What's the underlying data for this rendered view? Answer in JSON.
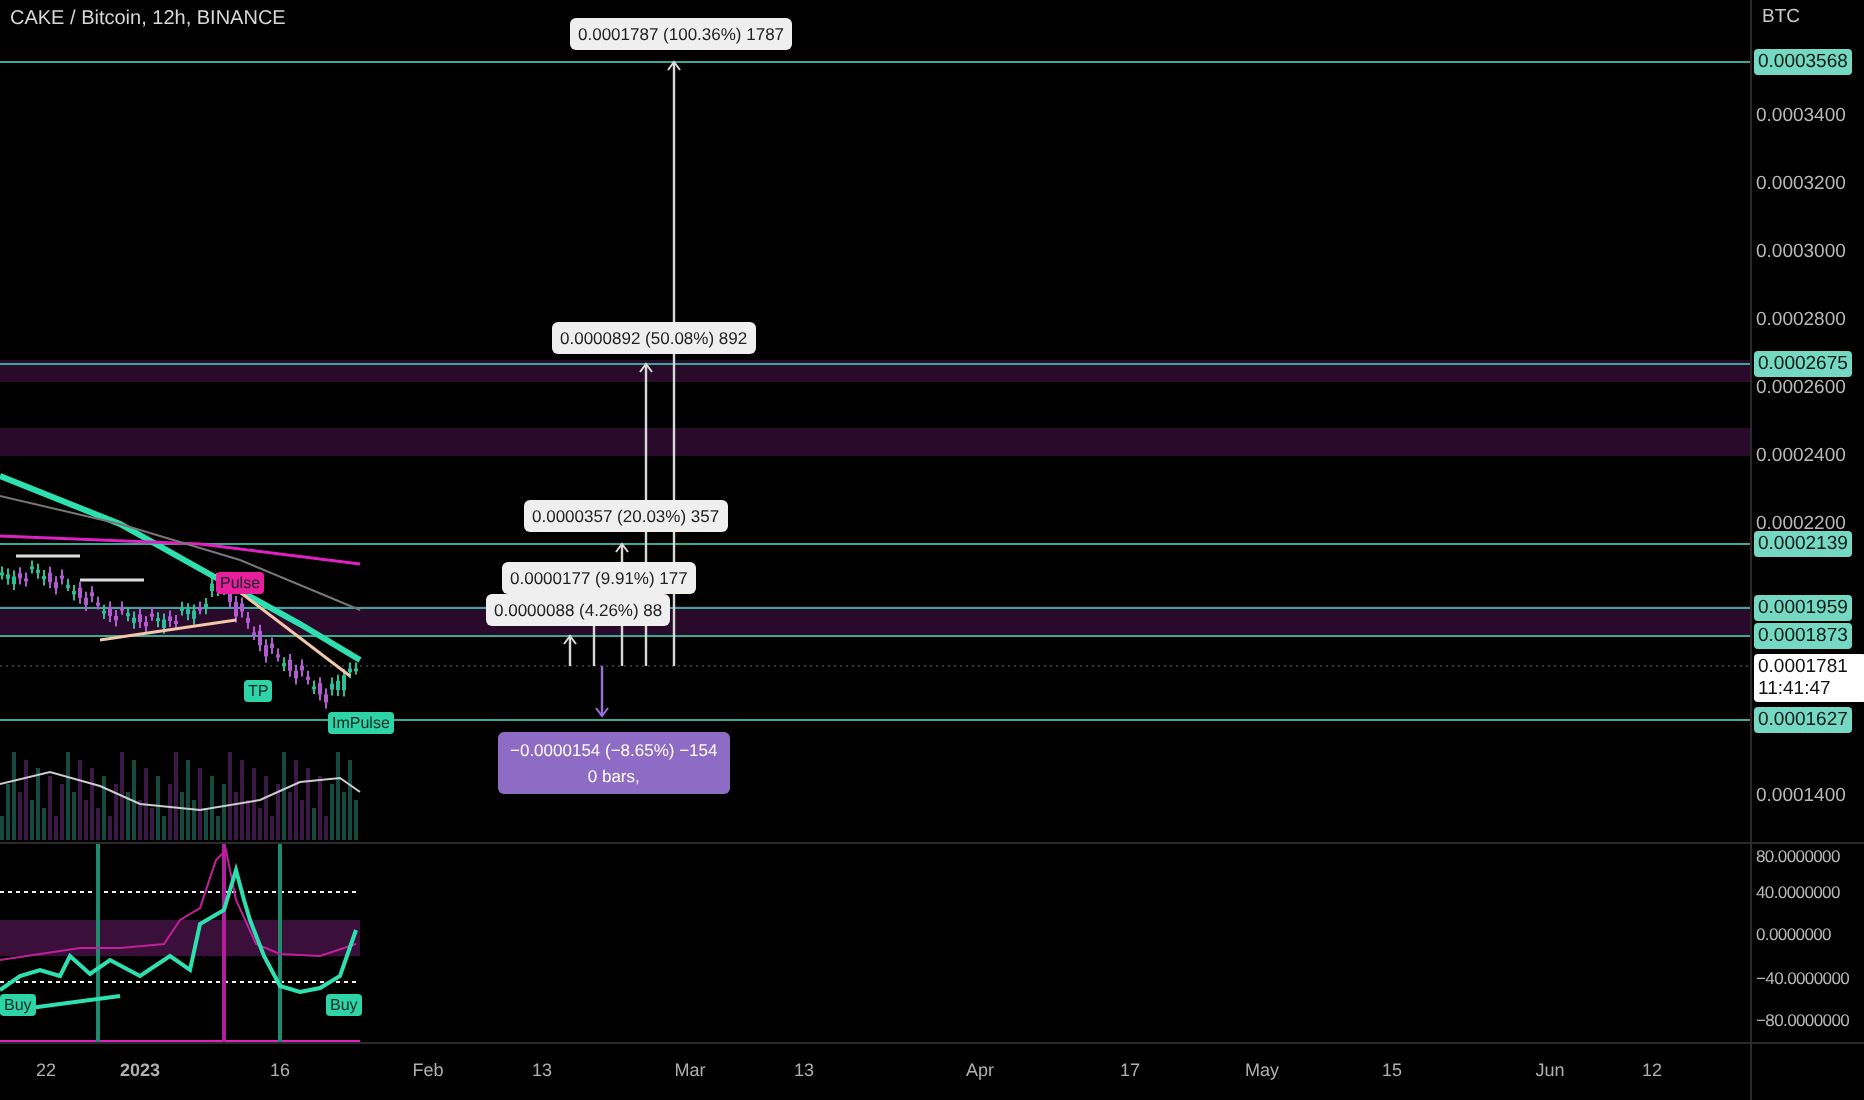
{
  "header": {
    "title": "CAKE / Bitcoin, 12h, BINANCE"
  },
  "price_axis": {
    "unit": "BTC",
    "ticks": [
      "0.0003400",
      "0.0003200",
      "0.0003000",
      "0.0002800",
      "0.0002600",
      "0.0002400",
      "0.0002200",
      "0.0001400"
    ]
  },
  "level_badges": [
    "0.0003568",
    "0.0002675",
    "0.0002139",
    "0.0001959",
    "0.0001873",
    "0.0001627"
  ],
  "current_price": {
    "price": "0.0001781",
    "countdown": "11:41:47"
  },
  "measurements": [
    {
      "kind": "up",
      "text": "0.0001787 (100.36%) 1787"
    },
    {
      "kind": "up",
      "text": "0.0000892 (50.08%) 892"
    },
    {
      "kind": "up",
      "text": "0.0000357 (20.03%) 357"
    },
    {
      "kind": "up",
      "text": "0.0000177 (9.91%) 177"
    },
    {
      "kind": "up",
      "text": "0.0000088 (4.26%) 88"
    },
    {
      "kind": "down",
      "text": "−0.0000154 (−8.65%) −154",
      "detail": "0 bars,"
    }
  ],
  "chart_labels": [
    {
      "text": "Pulse",
      "color": "#e91e9c"
    },
    {
      "text": "TP",
      "color": "#2ed3a8"
    },
    {
      "text": "ImPulse",
      "color": "#2ed3a8"
    },
    {
      "text": "Buy",
      "color": "#2ed3a8"
    },
    {
      "text": "Buy",
      "color": "#2ed3a8"
    }
  ],
  "oscillator_axis": {
    "ticks": [
      "80.0000000",
      "40.0000000",
      "0.0000000",
      "−40.0000000",
      "−80.0000000"
    ]
  },
  "time_axis": {
    "labels": [
      {
        "text": "22",
        "bold": false
      },
      {
        "text": "2023",
        "bold": true
      },
      {
        "text": "16",
        "bold": false
      },
      {
        "text": "Feb",
        "bold": false
      },
      {
        "text": "13",
        "bold": false
      },
      {
        "text": "Mar",
        "bold": false
      },
      {
        "text": "13",
        "bold": false
      },
      {
        "text": "Apr",
        "bold": false
      },
      {
        "text": "17",
        "bold": false
      },
      {
        "text": "May",
        "bold": false
      },
      {
        "text": "15",
        "bold": false
      },
      {
        "text": "Jun",
        "bold": false
      },
      {
        "text": "12",
        "bold": false
      }
    ]
  }
}
